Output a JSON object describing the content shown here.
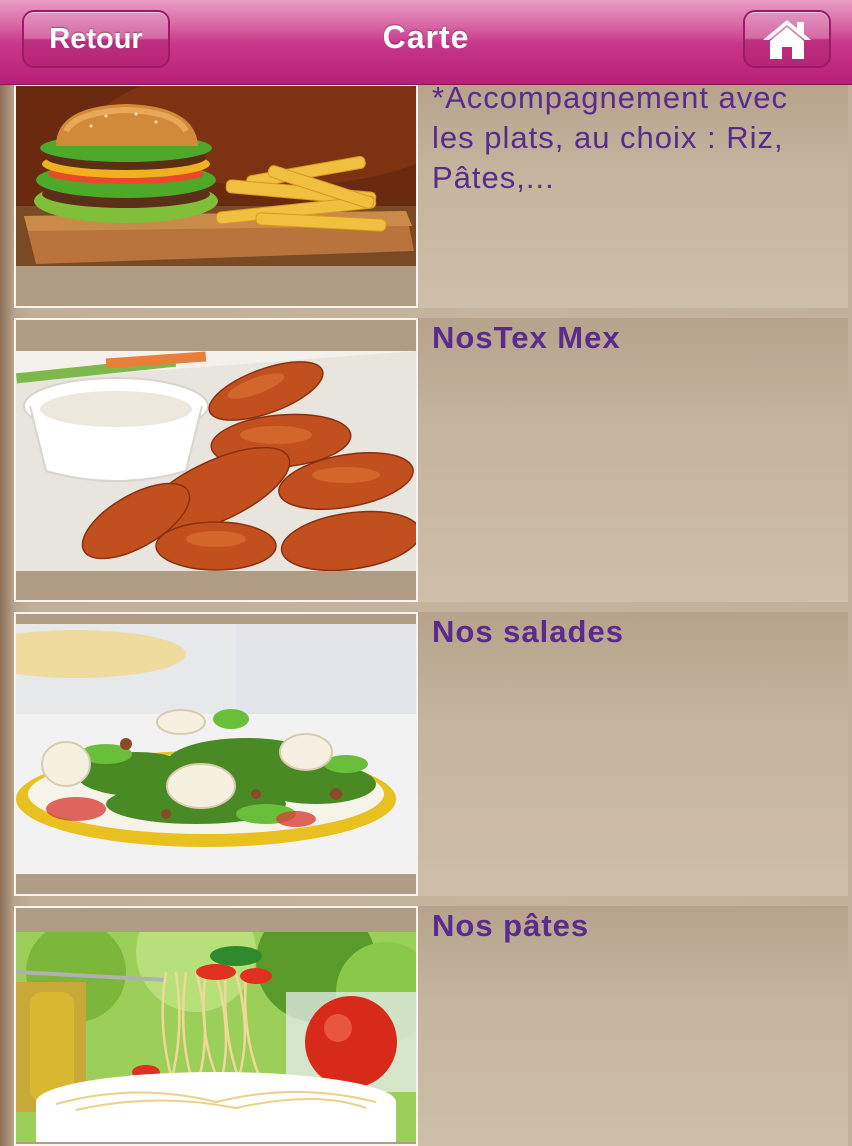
{
  "navbar": {
    "back_label": "Retour",
    "title": "Carte",
    "home_icon": "house-icon",
    "color_top": "#e79cc2",
    "color_bottom": "#b81f78"
  },
  "menu": {
    "items": [
      {
        "title": "",
        "description": "*Accompagnement avec les plats, au choix : Riz, Pâtes,...",
        "image": "burger-fries"
      },
      {
        "title": "NosTex Mex",
        "description": "",
        "image": "chicken-wings"
      },
      {
        "title": "Nos salades",
        "description": "",
        "image": "salad-plate"
      },
      {
        "title": "Nos pâtes",
        "description": "",
        "image": "spaghetti"
      }
    ],
    "text_color": "#5a2a8c"
  }
}
